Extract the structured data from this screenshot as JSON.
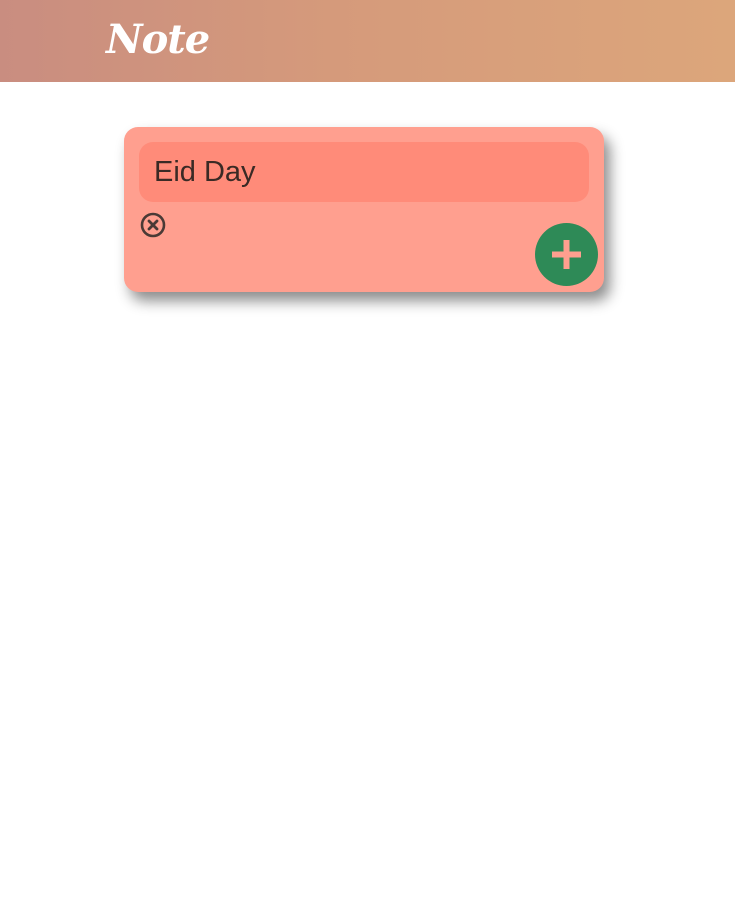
{
  "app": {
    "title": "Note",
    "header_gradient": [
      "#c98d80",
      "#dca67b"
    ]
  },
  "note": {
    "title": "Eid Day",
    "card_color": "#ff9f8f",
    "title_bg_color": "#ff8b79",
    "delete_icon": "close-circle-icon",
    "add_icon": "plus-icon",
    "add_button_color": "#2e8a57"
  }
}
